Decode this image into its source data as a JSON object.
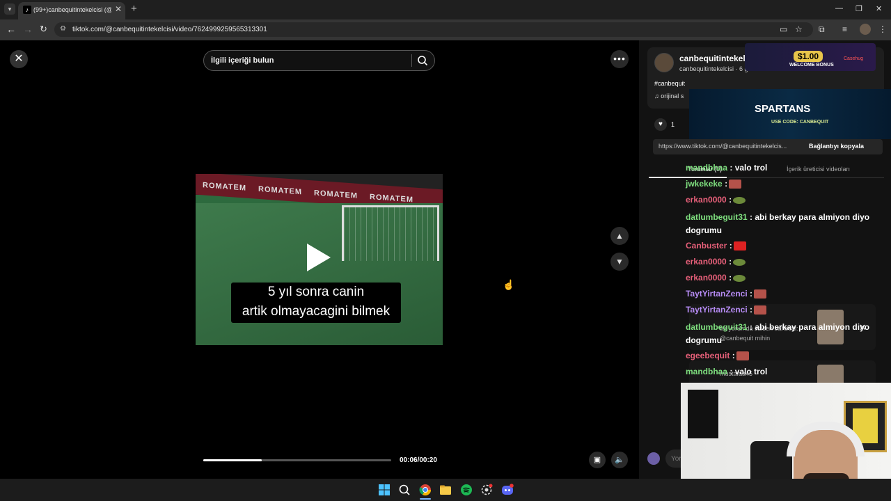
{
  "browser": {
    "tab_title": "(99+)canbequitintekelcisi (@ca",
    "url": "tiktok.com/@canbequitintekelcisi/video/7624999259565313301"
  },
  "video": {
    "search_placeholder": "İlgili içeriği bulun",
    "caption_line1": "5 yıl sonra canin",
    "caption_line2": "artik olmayacagini bilmek",
    "banner_brand": "ROMATEM",
    "time": "00:06/00:20",
    "progress": 0.31
  },
  "panel": {
    "username": "canbequitintekelcisi",
    "sub_info": "canbequitintekelcisi · 6 g",
    "hashtag": "#canbequit",
    "sound": "orijinal s",
    "like_count": "1",
    "link": "https://www.tiktok.com/@canbequitintekelcis...",
    "copy_link": "Bağlantıyı kopyala",
    "tab_comments": "Yorumlar (0)",
    "tab_creator": "İçerik üreticisi videoları",
    "comment_placeholder": "Yor"
  },
  "ads": {
    "ad1_amount": "$1.00",
    "ad1_sub": "WELCOME BONUS",
    "ad1_brand": "Casehug",
    "ad2_title": "SPARTANS",
    "ad2_sub": "USE CODE: CANBEQUIT"
  },
  "chat": [
    {
      "user": "mandbhaa",
      "msg": ": valo trol",
      "color": "#7fe07f"
    },
    {
      "user": "jwkekeke",
      "msg": ":",
      "color": "#7fe07f"
    },
    {
      "user": "erkan0000",
      "msg": ":",
      "color": "#e8607a"
    },
    {
      "user": "datlumbeguit31",
      "msg": ": abi berkay para almiyon diyo dogrumu",
      "color": "#7fe07f"
    },
    {
      "user": "Canbuster",
      "msg": ":",
      "color": "#e8607a"
    },
    {
      "user": "erkan0000",
      "msg": ":",
      "color": "#e8607a"
    },
    {
      "user": "erkan0000",
      "msg": ":",
      "color": "#e8607a"
    },
    {
      "user": "TaytYirtanZenci",
      "msg": ":",
      "color": "#b78cf5"
    },
    {
      "user": "TaytYirtanZenci",
      "msg": ":",
      "color": "#b78cf5"
    },
    {
      "user": "datlumbeguit31",
      "msg": ": abi berkay para almiyon diyo dogrumu",
      "color": "#7fe07f"
    },
    {
      "user": "egeebequit",
      "msg": ":",
      "color": "#e8607a"
    },
    {
      "user": "mandbhaa",
      "msg": ": valo trol",
      "color": "#7fe07f"
    }
  ],
  "notifications": {
    "mention_text": "bir yorumda sizden bahsetti:",
    "mention_user": "@canbequit mihin",
    "user2": "mustafaa45"
  }
}
